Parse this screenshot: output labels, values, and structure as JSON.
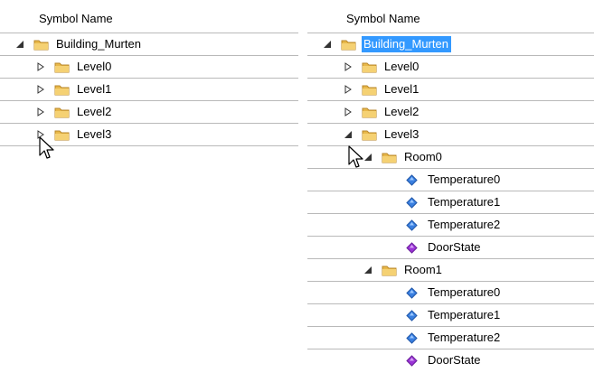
{
  "left_tree": {
    "header": "Symbol Name",
    "rows": [
      {
        "label": "Building_Murten"
      },
      {
        "label": "Level0"
      },
      {
        "label": "Level1"
      },
      {
        "label": "Level2"
      },
      {
        "label": "Level3"
      }
    ]
  },
  "right_tree": {
    "header": "Symbol Name",
    "rows": [
      {
        "label": "Building_Murten",
        "selected": true
      },
      {
        "label": "Level0"
      },
      {
        "label": "Level1"
      },
      {
        "label": "Level2"
      },
      {
        "label": "Level3"
      },
      {
        "label": "Room0"
      },
      {
        "label": "Temperature0"
      },
      {
        "label": "Temperature1"
      },
      {
        "label": "Temperature2"
      },
      {
        "label": "DoorState"
      },
      {
        "label": "Room1"
      },
      {
        "label": "Temperature0"
      },
      {
        "label": "Temperature1"
      },
      {
        "label": "Temperature2"
      },
      {
        "label": "DoorState"
      }
    ]
  },
  "colors": {
    "selection": "#3399ff",
    "folder": "#e8b84a",
    "temperature_icon": "#3a7fe0",
    "doorstate_icon": "#9a33d6"
  }
}
